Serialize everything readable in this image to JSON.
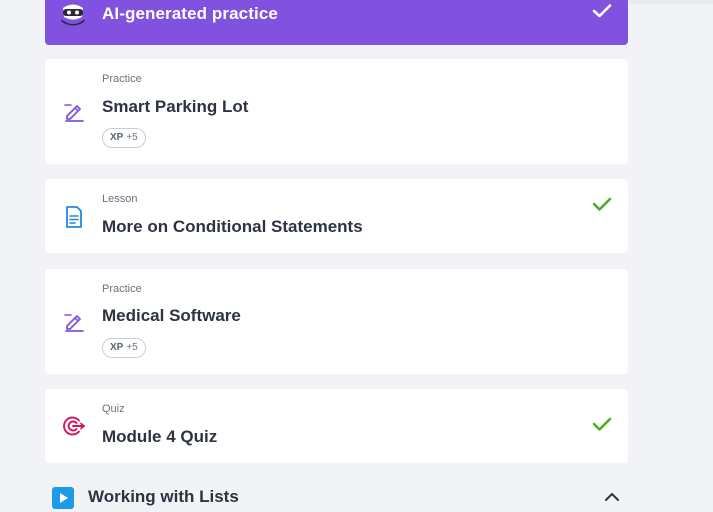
{
  "banner": {
    "title": "AI-generated practice",
    "completed": true,
    "bg_color": "#8152e0"
  },
  "items": [
    {
      "type": "Practice",
      "title": "Smart Parking Lot",
      "xp_label": "XP",
      "xp_value": "+5",
      "icon": "pencil-edit-icon",
      "completed": false
    },
    {
      "type": "Lesson",
      "title": "More on Conditional Statements",
      "icon": "lesson-document-icon",
      "completed": true
    },
    {
      "type": "Practice",
      "title": "Medical Software",
      "xp_label": "XP",
      "xp_value": "+5",
      "icon": "pencil-edit-icon",
      "completed": false
    },
    {
      "type": "Quiz",
      "title": "Module 4 Quiz",
      "icon": "target-icon",
      "completed": true
    }
  ],
  "section": {
    "title": "Working with Lists",
    "icon": "play-icon",
    "expanded": true
  },
  "colors": {
    "practice_icon": "#8152e0",
    "lesson_icon": "#1e88e5",
    "quiz_icon": "#d4145a",
    "check": "#4caf22",
    "section_icon": "#1e9be8"
  }
}
